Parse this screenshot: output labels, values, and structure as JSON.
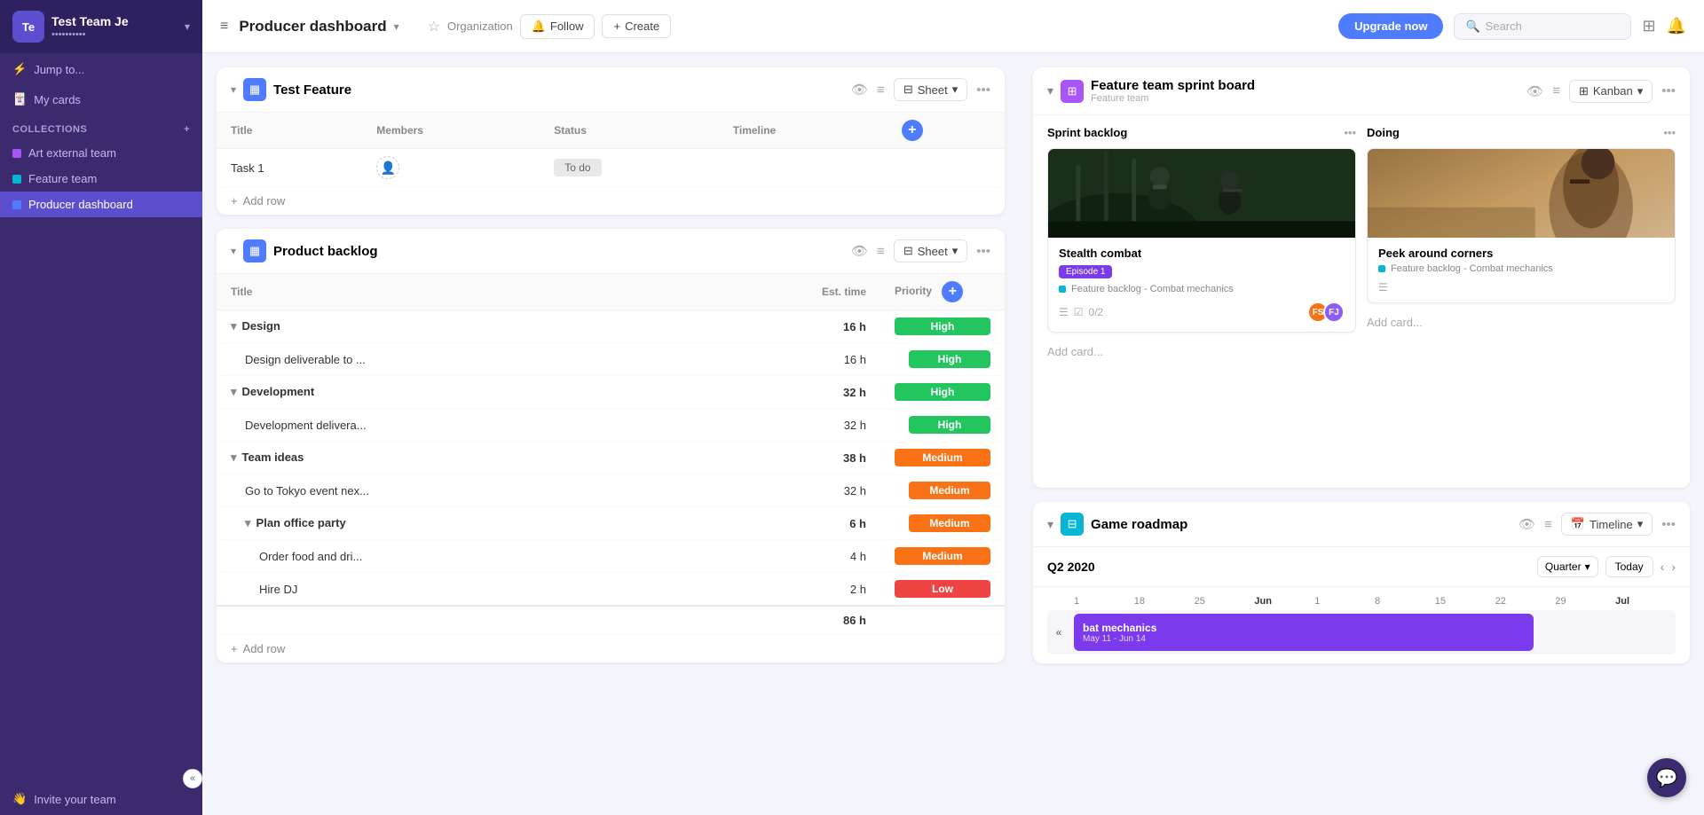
{
  "sidebar": {
    "team_avatar": "Te",
    "team_name": "Test Team Je",
    "team_sub": "••••••••••",
    "jump_to": "Jump to...",
    "my_cards": "My cards",
    "collections_label": "Collections",
    "items": [
      {
        "id": "art-external-team",
        "label": "Art external team",
        "color": "#a855f7",
        "active": false
      },
      {
        "id": "feature-team",
        "label": "Feature team",
        "color": "#06b6d4",
        "active": false
      },
      {
        "id": "producer-dashboard",
        "label": "Producer dashboard",
        "color": "#4f7cff",
        "active": true
      }
    ],
    "invite_team": "Invite your team",
    "collapse_label": "«"
  },
  "topbar": {
    "title": "Producer dashboard",
    "org_label": "Organization",
    "follow_label": "Follow",
    "create_label": "Create",
    "upgrade_label": "Upgrade now",
    "search_placeholder": "Search"
  },
  "test_feature": {
    "title": "Test Feature",
    "view_label": "Sheet",
    "columns": [
      "Title",
      "Members",
      "Status",
      "Timeline"
    ],
    "rows": [
      {
        "title": "Task 1",
        "members": "",
        "status": "To do",
        "timeline": ""
      }
    ],
    "add_row_label": "Add row"
  },
  "product_backlog": {
    "title": "Product backlog",
    "view_label": "Sheet",
    "columns": [
      "Title",
      "Est. time",
      "Priority"
    ],
    "groups": [
      {
        "name": "Design",
        "est_time": "16 h",
        "priority": "High",
        "priority_class": "high",
        "children": [
          {
            "title": "Design deliverable to ...",
            "est_time": "16 h",
            "priority": "High",
            "priority_class": "high"
          }
        ]
      },
      {
        "name": "Development",
        "est_time": "32 h",
        "priority": "High",
        "priority_class": "high",
        "children": [
          {
            "title": "Development delivera...",
            "est_time": "32 h",
            "priority": "High",
            "priority_class": "high"
          }
        ]
      },
      {
        "name": "Team ideas",
        "est_time": "38 h",
        "priority": "Medium",
        "priority_class": "medium",
        "children": [
          {
            "title": "Go to Tokyo event nex...",
            "est_time": "32 h",
            "priority": "Medium",
            "priority_class": "medium"
          },
          {
            "title": "Plan office party",
            "est_time": "6 h",
            "priority": "Medium",
            "priority_class": "medium",
            "is_subgroup": true,
            "children": [
              {
                "title": "Order food and dri...",
                "est_time": "4 h",
                "priority": "Medium",
                "priority_class": "medium"
              },
              {
                "title": "Hire DJ",
                "est_time": "2 h",
                "priority": "Low",
                "priority_class": "low"
              }
            ]
          }
        ]
      }
    ],
    "total_label": "86 h",
    "add_row_label": "Add row"
  },
  "feature_sprint_board": {
    "title": "Feature team sprint board",
    "subtitle": "Feature team",
    "view_label": "Kanban",
    "columns": [
      {
        "id": "sprint-backlog",
        "name": "Sprint backlog",
        "cards": [
          {
            "id": "stealth-combat",
            "title": "Stealth combat",
            "tag": "Episode 1",
            "label": "Feature backlog - Combat mechanics",
            "has_checklist": "0/2",
            "avatars": [
              "FS",
              "FJ"
            ]
          }
        ],
        "add_card_label": "Add card..."
      },
      {
        "id": "doing",
        "name": "Doing",
        "cards": [
          {
            "id": "peek-around-corners",
            "title": "Peek around corners",
            "label": "Feature backlog - Combat mechanics"
          }
        ],
        "add_card_label": "Add card..."
      }
    ]
  },
  "game_roadmap": {
    "title": "Game roadmap",
    "view_label": "Timeline",
    "q2_label": "Q2 2020",
    "quarter_select": "Quarter",
    "today_btn": "Today",
    "months": [
      "",
      "18",
      "25",
      "Jun",
      "1",
      "8",
      "15",
      "22",
      "29",
      "Jul"
    ],
    "bar": {
      "label": "bat mechanics",
      "sub_label": "May 11 - Jun 14",
      "left_pct": 0,
      "width_pct": 42
    }
  },
  "icons": {
    "hamburger": "≡",
    "star": "☆",
    "bell": "🔔",
    "search": "🔍",
    "grid": "⊞",
    "lightning": "⚡",
    "plus": "+",
    "chevron_down": "▾",
    "chevron_right": "▸",
    "chevron_left": "‹",
    "dots": "•••",
    "eye": "👁",
    "filter": "⚌",
    "collapse": "«",
    "card_icon": "▦",
    "kanban_icon": "⊞",
    "timeline_icon": "⊟"
  }
}
